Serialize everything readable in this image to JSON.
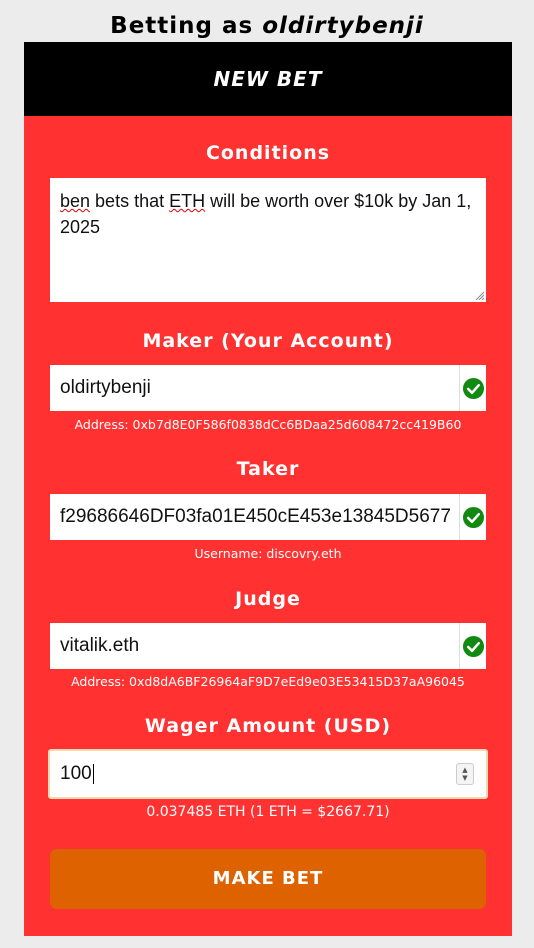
{
  "page": {
    "heading_prefix": "Betting as ",
    "heading_username": "oldirtybenji"
  },
  "card": {
    "title": "NEW BET"
  },
  "conditions": {
    "label": "Conditions",
    "text_part1": "ben",
    "text_part2": " bets that ",
    "text_part3": "ETH",
    "text_part4": " will be worth over $10k by Jan 1, 2025"
  },
  "maker": {
    "label": "Maker (Your Account)",
    "value": "oldirtybenji",
    "helper": "Address: 0xb7d8E0F586f0838dCc6BDaa25d608472cc419B60",
    "valid_icon": "check-circle-icon"
  },
  "taker": {
    "label": "Taker",
    "value": "f29686646DF03fa01E450cE453e13845D5677",
    "helper": "Username: discovry.eth",
    "valid_icon": "check-circle-icon"
  },
  "judge": {
    "label": "Judge",
    "value": "vitalik.eth",
    "helper": "Address: 0xd8dA6BF26964aF9D7eEd9e03E53415D37aA96045",
    "valid_icon": "check-circle-icon"
  },
  "wager": {
    "label": "Wager Amount (USD)",
    "value": "100",
    "conversion": "0.037485 ETH (1 ETH = $2667.71)"
  },
  "submit": {
    "label": "MAKE BET"
  },
  "colors": {
    "card_background": "#ff3131",
    "header_background": "#000000",
    "button_background": "#de6300",
    "valid_green": "#128a12"
  }
}
